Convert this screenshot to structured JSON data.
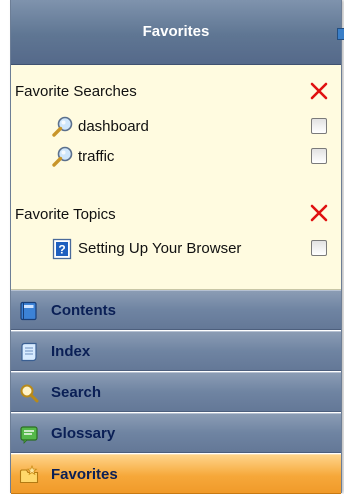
{
  "header": {
    "title": "Favorites"
  },
  "favorites": {
    "searches": {
      "title": "Favorite Searches",
      "remove_icon": "red-x-icon",
      "items": [
        {
          "label": "dashboard",
          "icon": "magnifier-icon",
          "checked": false
        },
        {
          "label": "traffic",
          "icon": "magnifier-icon",
          "checked": false
        }
      ]
    },
    "topics": {
      "title": "Favorite Topics",
      "remove_icon": "red-x-icon",
      "items": [
        {
          "label": "Setting Up Your Browser",
          "icon": "help-topic-icon",
          "checked": false
        }
      ]
    }
  },
  "nav": {
    "items": [
      {
        "label": "Contents",
        "icon": "book-icon",
        "active": false
      },
      {
        "label": "Index",
        "icon": "index-page-icon",
        "active": false
      },
      {
        "label": "Search",
        "icon": "search-icon",
        "active": false
      },
      {
        "label": "Glossary",
        "icon": "glossary-icon",
        "active": false
      },
      {
        "label": "Favorites",
        "icon": "star-folder-icon",
        "active": true
      }
    ]
  },
  "colors": {
    "header": "#5f7693",
    "content_background": "#fffbe0",
    "nav_background": "#6f84a2",
    "nav_text": "#0a1f55",
    "active_tab": "#f6a83a",
    "remove_x": "#e01010"
  }
}
